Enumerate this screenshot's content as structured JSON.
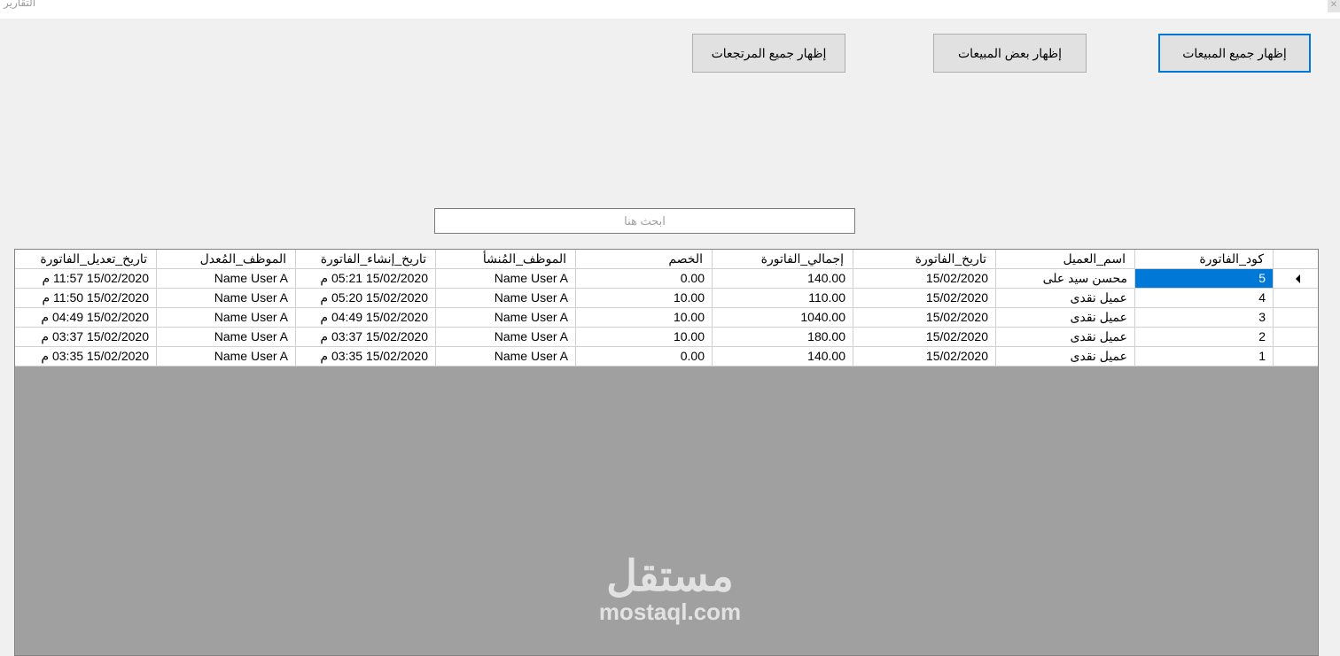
{
  "window": {
    "title": "التقارير",
    "close_glyph": "✕"
  },
  "buttons": {
    "show_all_sales": "إظهار جميع المبيعات",
    "show_some_sales": "إظهار بعض المبيعات",
    "show_all_returns": "إظهار جميع المرتجعات"
  },
  "search": {
    "placeholder": "ابحث هنا",
    "value": ""
  },
  "table": {
    "columns": [
      "كود_الفاتورة",
      "اسم_العميل",
      "تاريخ_الفاتورة",
      "إجمالي_الفاتورة",
      "الخصم",
      "الموظف_المُنشأ",
      "تاريخ_إنشاء_الفاتورة",
      "الموظف_المُعدل",
      "تاريخ_تعديل_الفاتورة"
    ],
    "rows": [
      [
        "5",
        "محسن سيد على",
        "15/02/2020",
        "140.00",
        "0.00",
        "Name User A",
        "15/02/2020 05:21 م",
        "Name User A",
        "15/02/2020 11:57 م"
      ],
      [
        "4",
        "عميل نقدى",
        "15/02/2020",
        "110.00",
        "10.00",
        "Name User A",
        "15/02/2020 05:20 م",
        "Name User A",
        "15/02/2020 11:50 م"
      ],
      [
        "3",
        "عميل نقدى",
        "15/02/2020",
        "1040.00",
        "10.00",
        "Name User A",
        "15/02/2020 04:49 م",
        "Name User A",
        "15/02/2020 04:49 م"
      ],
      [
        "2",
        "عميل نقدى",
        "15/02/2020",
        "180.00",
        "10.00",
        "Name User A",
        "15/02/2020 03:37 م",
        "Name User A",
        "15/02/2020 03:37 م"
      ],
      [
        "1",
        "عميل نقدى",
        "15/02/2020",
        "140.00",
        "0.00",
        "Name User A",
        "15/02/2020 03:35 م",
        "Name User A",
        "15/02/2020 03:35 م"
      ]
    ],
    "selected_row": 0
  },
  "watermark": {
    "arabic": "مستقل",
    "latin": "mostaql.com"
  },
  "colors": {
    "selection": "#0078d7",
    "default_button_border": "#0078d7",
    "grid_background": "#a0a0a0"
  }
}
